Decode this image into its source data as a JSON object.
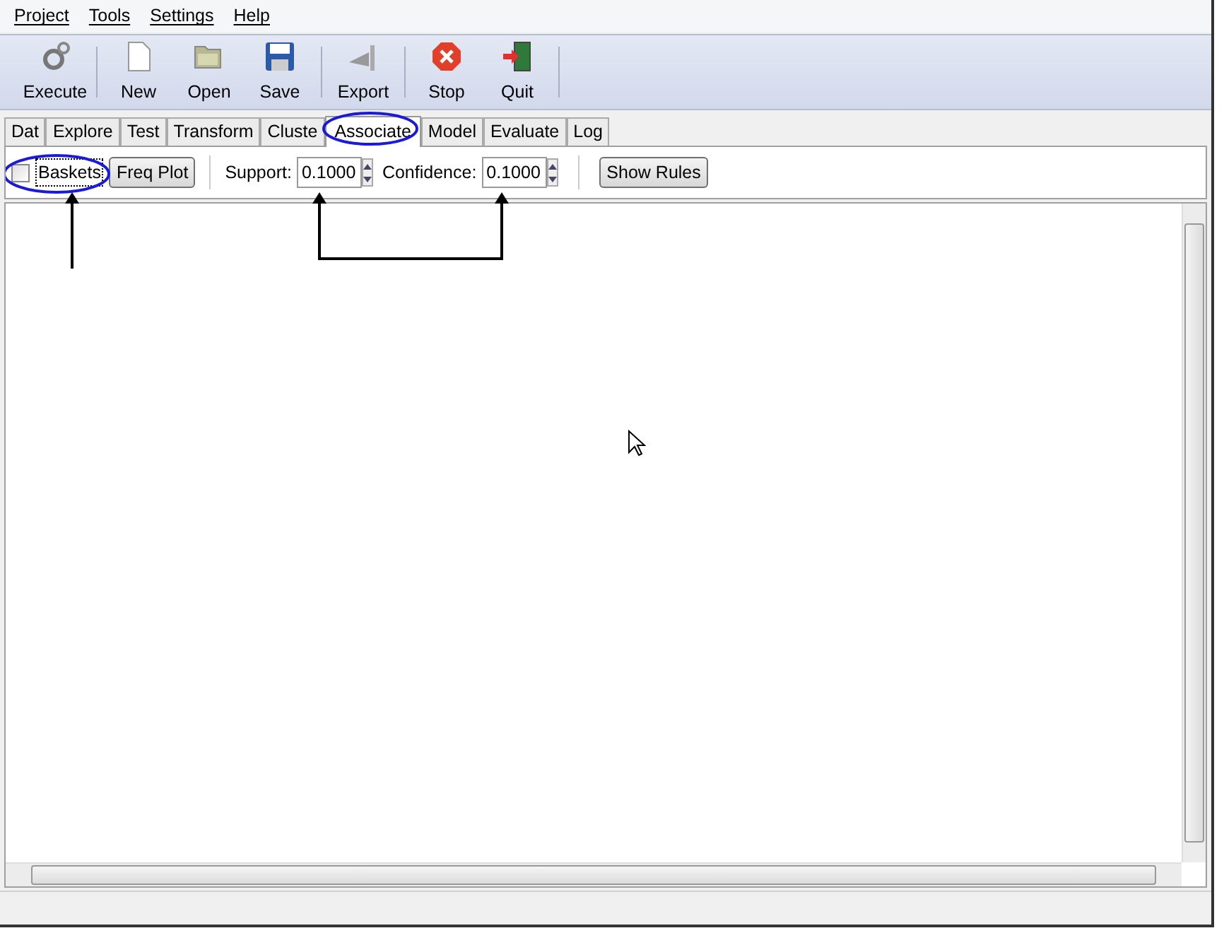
{
  "menu": [
    "Project",
    "Tools",
    "Settings",
    "Help"
  ],
  "toolbar": [
    {
      "label": "Execute",
      "kind": "gear"
    },
    {
      "label": "New",
      "kind": "page"
    },
    {
      "label": "Open",
      "kind": "folder"
    },
    {
      "label": "Save",
      "kind": "disk"
    },
    {
      "label": "Export",
      "kind": "export"
    },
    {
      "label": "Stop",
      "kind": "stop"
    },
    {
      "label": "Quit",
      "kind": "door"
    }
  ],
  "tabs": [
    {
      "label": "Dat",
      "selected": false
    },
    {
      "label": "Explore",
      "selected": false
    },
    {
      "label": "Test",
      "selected": false
    },
    {
      "label": "Transform",
      "selected": false
    },
    {
      "label": "Cluste",
      "selected": false
    },
    {
      "label": "Associate",
      "selected": true
    },
    {
      "label": "Model",
      "selected": false
    },
    {
      "label": "Evaluate",
      "selected": false
    },
    {
      "label": "Log",
      "selected": false
    }
  ],
  "options": {
    "baskets": {
      "label": "Baskets",
      "checked": false
    },
    "freq_plot": "Freq Plot",
    "support": {
      "label": "Support:",
      "value": "0.1000"
    },
    "confidence": {
      "label": "Confidence:",
      "value": "0.1000"
    },
    "show_rules": "Show Rules"
  }
}
